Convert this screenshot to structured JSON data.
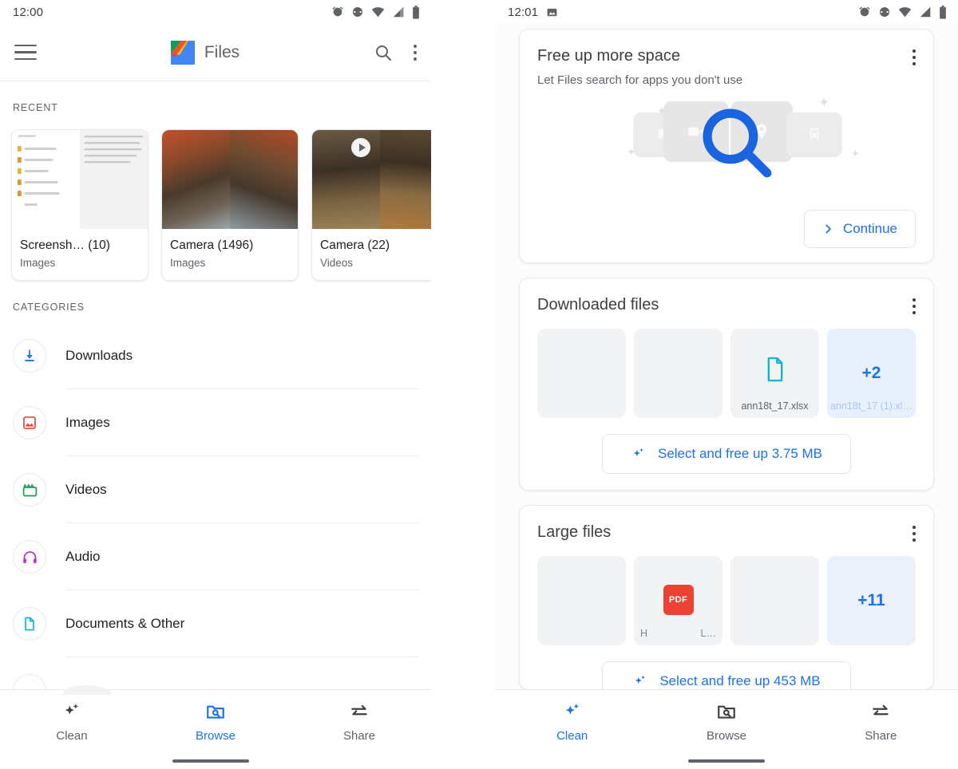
{
  "left_phone": {
    "status_bar": {
      "time": "12:00",
      "icons": [
        "alarm-icon",
        "vibrate-icon",
        "wifi-icon",
        "signal-icon",
        "battery-icon"
      ]
    },
    "app_bar": {
      "menu_icon": "hamburger-menu-icon",
      "logo": "files-app-logo",
      "title": "Files",
      "search_icon": "search-icon",
      "overflow_icon": "more-vert-icon"
    },
    "recent": {
      "label": "RECENT",
      "cards": [
        {
          "title": "Screensh…  (10)",
          "subtitle": "Images",
          "kind": "document",
          "has_play": false
        },
        {
          "title": "Camera (1496)",
          "subtitle": "Images",
          "kind": "photo",
          "has_play": false
        },
        {
          "title": "Camera (22)",
          "subtitle": "Videos",
          "kind": "video",
          "has_play": true
        }
      ]
    },
    "categories": {
      "label": "CATEGORIES",
      "items": [
        {
          "label": "Downloads",
          "icon": "download-icon",
          "color": "#1a73e8"
        },
        {
          "label": "Images",
          "icon": "image-icon",
          "color": "#ea4335"
        },
        {
          "label": "Videos",
          "icon": "video-clapper-icon",
          "color": "#1e9e5a"
        },
        {
          "label": "Audio",
          "icon": "headphones-icon",
          "color": "#b832d6"
        },
        {
          "label": "Documents & Other",
          "icon": "document-icon",
          "color": "#12b5cb"
        }
      ]
    },
    "bottom_nav": {
      "items": [
        {
          "label": "Clean",
          "icon": "sparkle-icon",
          "active": false
        },
        {
          "label": "Browse",
          "icon": "folder-search-icon",
          "active": true
        },
        {
          "label": "Share",
          "icon": "share-arrows-icon",
          "active": false
        }
      ]
    }
  },
  "right_phone": {
    "status_bar": {
      "time": "12:01",
      "left_icons": [
        "screenshot-icon"
      ],
      "icons": [
        "alarm-icon",
        "vibrate-icon",
        "wifi-icon",
        "signal-icon",
        "battery-icon"
      ]
    },
    "cards": [
      {
        "title": "Free up more space",
        "subtitle": "Let Files search for apps you don't use",
        "overflow_icon": "more-vert-icon",
        "illustration": "app-icons-magnifier",
        "button": {
          "label": "Continue",
          "icon": "chevron-right-icon"
        }
      },
      {
        "title": "Downloaded files",
        "overflow_icon": "more-vert-icon",
        "tiles": [
          {
            "kind": "photo",
            "filename": ""
          },
          {
            "kind": "photo",
            "filename": ""
          },
          {
            "kind": "doc",
            "filename": "ann18t_17.xlsx"
          },
          {
            "kind": "more",
            "filename": "ann18t_17 (1).xl…",
            "badge": "+2"
          }
        ],
        "button": {
          "label": "Select and free up 3.75 MB",
          "icon": "sparkle-icon"
        }
      },
      {
        "title": "Large files",
        "overflow_icon": "more-vert-icon",
        "tiles": [
          {
            "kind": "photo",
            "filename": ""
          },
          {
            "kind": "pdf",
            "corner_left": "H",
            "corner_right": "L…"
          },
          {
            "kind": "photo",
            "filename": ""
          },
          {
            "kind": "more",
            "badge": "+11"
          }
        ],
        "button": {
          "label": "Select and free up 453 MB",
          "icon": "sparkle-icon"
        }
      }
    ],
    "bottom_nav": {
      "items": [
        {
          "label": "Clean",
          "icon": "sparkle-icon",
          "active": true
        },
        {
          "label": "Browse",
          "icon": "folder-search-icon",
          "active": false
        },
        {
          "label": "Share",
          "icon": "share-arrows-icon",
          "active": false
        }
      ]
    }
  },
  "colors": {
    "accent_blue": "#1a73e8",
    "text_primary": "#202124",
    "text_secondary": "#5f6368",
    "divider": "#eceff1"
  }
}
